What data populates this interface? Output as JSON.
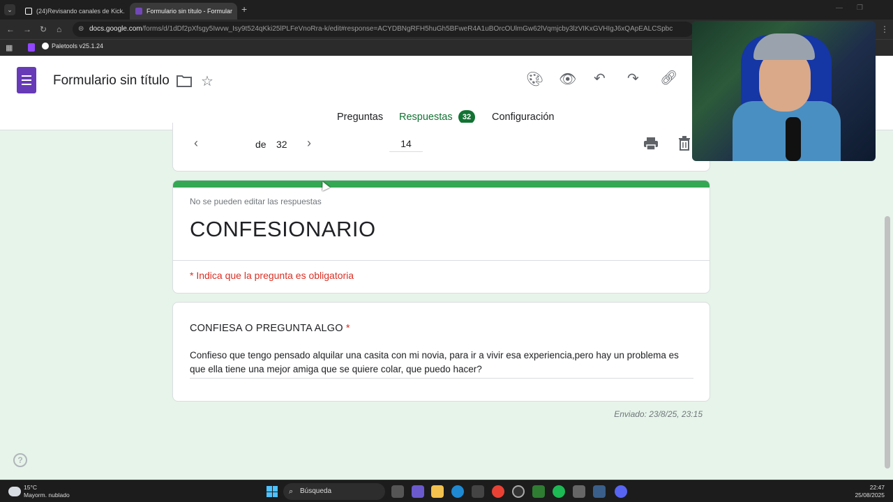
{
  "browser": {
    "tabs": [
      {
        "label": "(24)Revisando canales de Kick.",
        "active": false
      },
      {
        "label": "Formulario sin título - Formular",
        "active": true
      }
    ],
    "url_host": "docs.google.com",
    "url_path": "/forms/d/1dDf2pXfsgy5Iwvw_Isy9t524qKki25lPLFeVnoRra-k/edit#response=ACYDBNgRFH5huGh5BFweR4A1uBOrcOUlmGw62lVqmjcby3lzVIKxGVHIgJ6xQApEALCSpbc",
    "bookmark": "Paletools v25.1.24"
  },
  "forms": {
    "title": "Formulario sin título",
    "tabs": {
      "questions": "Preguntas",
      "responses": "Respuestas",
      "responses_count": "32",
      "settings": "Configuración"
    }
  },
  "pager": {
    "current": "14",
    "of_label": "de",
    "total": "32"
  },
  "response": {
    "locked_note": "No se pueden editar las respuestas",
    "form_heading": "CONFESIONARIO",
    "required_note": "* Indica que la pregunta es obligatoria",
    "question": "CONFIESA O PREGUNTA ALGO",
    "required_mark": "*",
    "answer": "Confieso que tengo pensado alquilar una casita con mi novia, para ir a vivir esa experiencia,pero hay un problema es que ella tiene una mejor amiga que se quiere colar, que puedo hacer?",
    "submitted": "Enviado: 23/8/25, 23:15"
  },
  "taskbar": {
    "temp": "15°C",
    "weather": "Mayorm. nublado",
    "search": "Búsqueda",
    "time": "22:47",
    "date": "25/08/2025"
  },
  "colors": {
    "accent": "#137333",
    "header_bar": "#34a853",
    "required": "#d93025",
    "page_bg": "#e6f4ea",
    "forms_logo": "#673ab7"
  },
  "icons": [
    "palette-icon",
    "eye-icon",
    "undo-icon",
    "redo-icon",
    "link-icon",
    "folder-icon",
    "star-icon",
    "print-icon",
    "trash-icon",
    "chevron-left-icon",
    "chevron-right-icon",
    "help-icon"
  ]
}
